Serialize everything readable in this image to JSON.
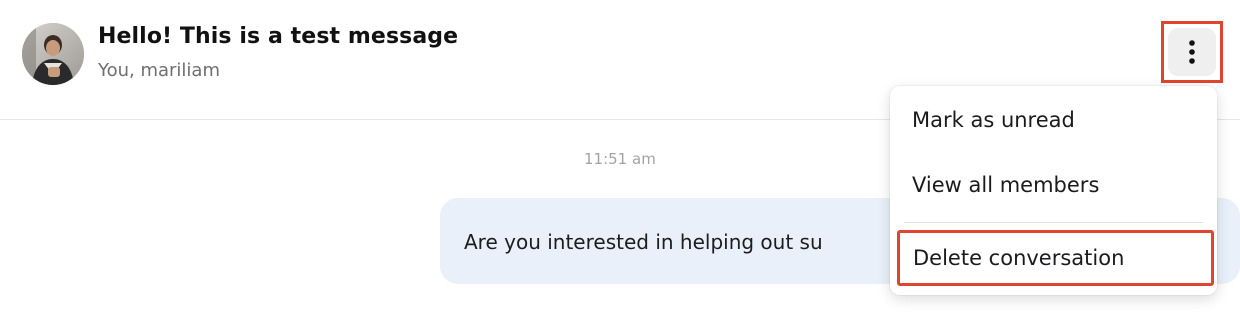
{
  "conversation": {
    "title": "Hello! This is a test message",
    "participants": "You, mariliam"
  },
  "icons": {
    "more": "more-vertical-icon",
    "avatar": "avatar"
  },
  "messages": [
    {
      "timestamp": "11:51 am",
      "text": "Are you interested in helping out su"
    }
  ],
  "menu": {
    "items": [
      {
        "label": "Mark as unread"
      },
      {
        "label": "View all members"
      },
      {
        "label": "Delete conversation"
      }
    ]
  },
  "colors": {
    "highlight": "#e0452f",
    "bubble": "#e9f0f9"
  }
}
